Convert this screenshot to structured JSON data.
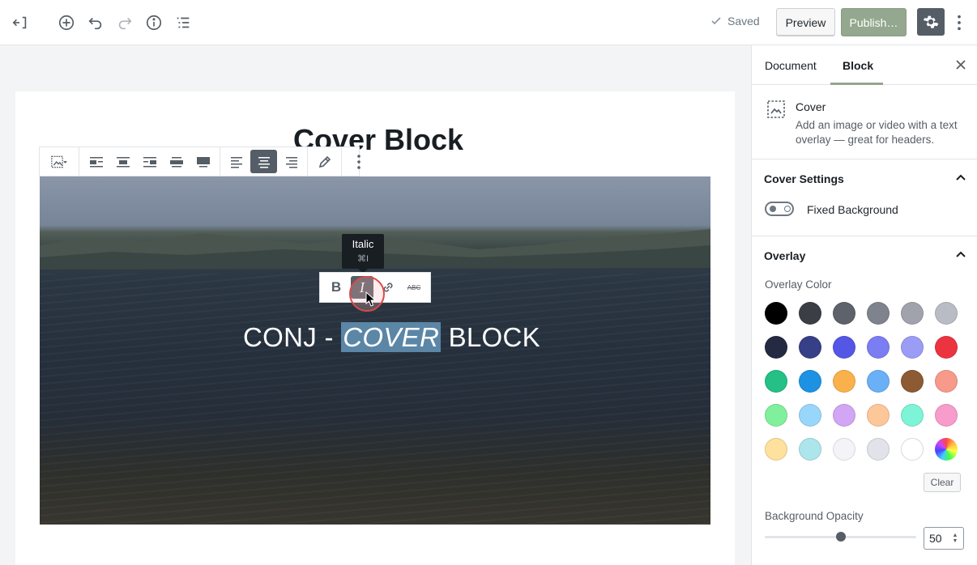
{
  "topbar": {
    "saved_label": "Saved",
    "preview_label": "Preview",
    "publish_label": "Publish…",
    "icons": [
      "back-icon",
      "add-block-icon",
      "undo-icon",
      "redo-icon",
      "info-icon",
      "outline-icon",
      "gear-icon",
      "more-icon"
    ]
  },
  "editor": {
    "post_title": "Cover Block",
    "block_toolbar": {
      "icons": [
        "cover-image-icon",
        "align-left-icon",
        "align-center-block-icon",
        "align-right-icon",
        "align-wide-icon",
        "align-full-icon",
        "text-align-left-icon",
        "text-align-center-icon",
        "text-align-right-icon",
        "pencil-icon",
        "more-vertical-icon"
      ],
      "active": "text-align-center"
    },
    "cover": {
      "text_before": "CONJ - ",
      "text_selected": "COVER",
      "text_after": " BLOCK"
    },
    "format_toolbar": {
      "bold_label": "B",
      "italic_label": "I",
      "strikethrough_label": "ABC",
      "active": "italic"
    },
    "tooltip": {
      "title": "Italic",
      "shortcut": "⌘I"
    }
  },
  "sidebar": {
    "tabs": [
      {
        "label": "Document"
      },
      {
        "label": "Block"
      }
    ],
    "active_tab": "Block",
    "block": {
      "name": "Cover",
      "description": "Add an image or video with a text overlay — great for headers."
    },
    "cover_settings": {
      "title": "Cover Settings",
      "fixed_background_label": "Fixed Background",
      "fixed_background_on": false
    },
    "overlay": {
      "title": "Overlay",
      "color_label": "Overlay Color",
      "colors": [
        "#000000",
        "#3b3e45",
        "#5e626a",
        "#7f838d",
        "#a0a3ab",
        "#b9bcc4",
        "#252a43",
        "#373f88",
        "#5457e5",
        "#7b7ef2",
        "#9a9cf6",
        "#ec3441",
        "#24c086",
        "#1d92e3",
        "#fbb14b",
        "#6ab0f7",
        "#8c5a33",
        "#f79a8a",
        "#81f09c",
        "#99d6fb",
        "#d2a6f4",
        "#fdc79a",
        "#7df4d5",
        "#f89ccb",
        "#fde19c",
        "#ade5ec",
        "#f3f3f8",
        "#e2e3ea",
        "#ffffff",
        "rainbow"
      ],
      "clear_label": "Clear",
      "opacity_label": "Background Opacity",
      "opacity_value": "50",
      "opacity_fraction": 0.5
    }
  }
}
